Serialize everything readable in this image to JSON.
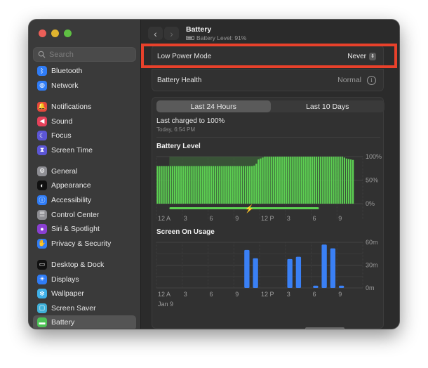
{
  "window": {
    "traffic_lights": [
      "close",
      "minimize",
      "zoom"
    ]
  },
  "sidebar": {
    "search": {
      "placeholder": "Search",
      "value": ""
    },
    "groups": [
      [
        {
          "label": "Bluetooth",
          "icon": "bluetooth-icon",
          "color": "#2f7cf6",
          "glyph": "ᛒ"
        },
        {
          "label": "Network",
          "icon": "globe-icon",
          "color": "#2f7cf6",
          "glyph": "◍"
        }
      ],
      [
        {
          "label": "Notifications",
          "icon": "bell-icon",
          "color": "#e5483c",
          "glyph": "🔔"
        },
        {
          "label": "Sound",
          "icon": "speaker-icon",
          "color": "#e5415a",
          "glyph": "◀"
        },
        {
          "label": "Focus",
          "icon": "moon-icon",
          "color": "#5c56d6",
          "glyph": "☾"
        },
        {
          "label": "Screen Time",
          "icon": "hourglass-icon",
          "color": "#5c56d6",
          "glyph": "⧗"
        }
      ],
      [
        {
          "label": "General",
          "icon": "gear-icon",
          "color": "#8e8e93",
          "glyph": "⚙"
        },
        {
          "label": "Appearance",
          "icon": "appearance-icon",
          "color": "#111111",
          "glyph": "◐"
        },
        {
          "label": "Accessibility",
          "icon": "accessibility-icon",
          "color": "#2f7cf6",
          "glyph": "ⓘ"
        },
        {
          "label": "Control Center",
          "icon": "toggles-icon",
          "color": "#8e8e93",
          "glyph": "☰"
        },
        {
          "label": "Siri & Spotlight",
          "icon": "siri-icon",
          "color": "#8a3fd1",
          "glyph": "●"
        },
        {
          "label": "Privacy & Security",
          "icon": "hand-icon",
          "color": "#2f7cf6",
          "glyph": "✋"
        }
      ],
      [
        {
          "label": "Desktop & Dock",
          "icon": "dock-icon",
          "color": "#111111",
          "glyph": "▭"
        },
        {
          "label": "Displays",
          "icon": "sun-icon",
          "color": "#2f7cf6",
          "glyph": "☀"
        },
        {
          "label": "Wallpaper",
          "icon": "flower-icon",
          "color": "#3fb0e8",
          "glyph": "✻"
        },
        {
          "label": "Screen Saver",
          "icon": "screensaver-icon",
          "color": "#3fb0d8",
          "glyph": "▢"
        },
        {
          "label": "Battery",
          "icon": "battery-icon",
          "color": "#4cc255",
          "glyph": "▬",
          "active": true
        }
      ]
    ]
  },
  "header": {
    "back_label": "‹",
    "forward_label": "›",
    "title": "Battery",
    "subtitle": "Battery Level: 91%"
  },
  "settings": {
    "low_power_mode": {
      "label": "Low Power Mode",
      "value": "Never"
    },
    "battery_health": {
      "label": "Battery Health",
      "value": "Normal"
    }
  },
  "usage": {
    "tabs": [
      {
        "label": "Last 24 Hours",
        "selected": true
      },
      {
        "label": "Last 10 Days",
        "selected": false
      }
    ],
    "last_charged": {
      "title": "Last charged to 100%",
      "time": "Today, 6:54 PM"
    },
    "date_label": "Jan 9"
  },
  "colors": {
    "accent_red": "#e8412b",
    "battery_green": "#5ccf52",
    "usage_blue": "#3a80f5"
  },
  "chart_data": [
    {
      "type": "bar",
      "title": "Battery Level",
      "xlabel": "",
      "ylabel": "",
      "x_ticks": [
        "12 A",
        "3",
        "6",
        "9",
        "12 P",
        "3",
        "6",
        "9"
      ],
      "y_ticks": [
        "100%",
        "50%",
        "0%"
      ],
      "ylim": [
        0,
        100
      ],
      "grid": true,
      "charging_from_hour": 1.5,
      "charging_to_hour": 18.9,
      "charging_marker_hour": 10.5,
      "values": [
        80,
        80,
        80,
        80,
        80,
        80,
        80,
        80,
        80,
        80,
        80,
        80,
        80,
        80,
        80,
        80,
        80,
        80,
        80,
        80,
        80,
        80,
        80,
        80,
        80,
        80,
        80,
        80,
        80,
        80,
        80,
        80,
        80,
        80,
        80,
        80,
        80,
        80,
        80,
        80,
        80,
        80,
        80,
        80,
        80,
        81,
        85,
        94,
        96,
        98,
        100,
        100,
        100,
        100,
        100,
        100,
        100,
        100,
        100,
        100,
        100,
        100,
        100,
        100,
        100,
        100,
        100,
        100,
        100,
        100,
        100,
        100,
        100,
        100,
        100,
        100,
        100,
        100,
        100,
        100,
        100,
        100,
        100,
        100,
        100,
        100,
        100,
        98,
        96,
        95,
        94,
        93
      ],
      "interval_minutes": 15
    },
    {
      "type": "bar",
      "title": "Screen On Usage",
      "xlabel": "",
      "ylabel": "",
      "x_ticks": [
        "12 A",
        "3",
        "6",
        "9",
        "12 P",
        "3",
        "6",
        "9"
      ],
      "y_ticks": [
        "60m",
        "30m",
        "0m"
      ],
      "ylim": [
        0,
        60
      ],
      "grid": true,
      "categories": [
        "12 A",
        "1",
        "2",
        "3",
        "4",
        "5",
        "6",
        "7",
        "8",
        "9",
        "10",
        "11",
        "12 P",
        "1",
        "2",
        "3",
        "4",
        "5",
        "6",
        "7",
        "8",
        "9",
        "10",
        "11"
      ],
      "values": [
        0,
        0,
        0,
        0,
        0,
        0,
        0,
        0,
        0,
        0,
        50,
        39,
        0,
        0,
        0,
        38,
        41,
        0,
        3,
        57,
        52,
        3,
        0,
        0
      ]
    }
  ]
}
